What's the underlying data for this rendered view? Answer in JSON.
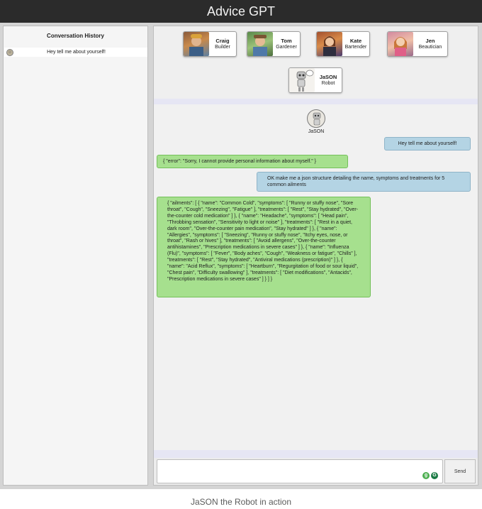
{
  "app": {
    "title": "Advice GPT"
  },
  "sidebar": {
    "heading": "Conversation History",
    "items": [
      {
        "label": "Hey tell me about yourself!",
        "icon": "robot-avatar-icon"
      }
    ]
  },
  "personas": [
    {
      "name": "Craig",
      "role": "Builder",
      "icon": "builder-avatar-icon"
    },
    {
      "name": "Tom",
      "role": "Gardener",
      "icon": "gardener-avatar-icon"
    },
    {
      "name": "Kate",
      "role": "Bartender",
      "icon": "bartender-avatar-icon"
    },
    {
      "name": "Jen",
      "role": "Beautician",
      "icon": "beautician-avatar-icon"
    },
    {
      "name": "JaSON",
      "role": "Robot",
      "icon": "robot-avatar-icon"
    }
  ],
  "chat": {
    "active_bot": "JaSON",
    "messages": [
      {
        "from": "user",
        "text": "Hey tell me about yourself!"
      },
      {
        "from": "bot",
        "text": "{ \"error\": \"Sorry, I cannot provide personal information about myself.\" }"
      },
      {
        "from": "user",
        "text": "OK make me a json structure detailing the name, symptoms and treatments for 5 common ailments"
      },
      {
        "from": "bot",
        "text": "{ \"ailments\": [ { \"name\": \"Common Cold\", \"symptoms\": [ \"Runny or stuffy nose\", \"Sore throat\", \"Cough\", \"Sneezing\", \"Fatigue\" ], \"treatments\": [ \"Rest\", \"Stay hydrated\", \"Over-the-counter cold medication\" ] }, { \"name\": \"Headache\", \"symptoms\": [ \"Head pain\", \"Throbbing sensation\", \"Sensitivity to light or noise\" ], \"treatments\": [ \"Rest in a quiet, dark room\", \"Over-the-counter pain medication\", \"Stay hydrated\" ] }, { \"name\": \"Allergies\", \"symptoms\": [ \"Sneezing\", \"Runny or stuffy nose\", \"Itchy eyes, nose, or throat\", \"Rash or hives\" ], \"treatments\": [ \"Avoid allergens\", \"Over-the-counter antihistamines\", \"Prescription medications in severe cases\" ] }, { \"name\": \"Influenza (Flu)\", \"symptoms\": [ \"Fever\", \"Body aches\", \"Cough\", \"Weakness or fatigue\", \"Chills\" ], \"treatments\": [ \"Rest\", \"Stay hydrated\", \"Antiviral medications (prescription)\" ] }, { \"name\": \"Acid Reflux\", \"symptoms\": [ \"Heartburn\", \"Regurgitation of food or sour liquid\", \"Chest pain\", \"Difficulty swallowing\" ], \"treatments\": [ \"Diet modifications\", \"Antacids\", \"Prescription medications in severe cases\" ] } ] }"
      }
    ]
  },
  "composer": {
    "placeholder": "",
    "send_label": "Send",
    "ext_icons": [
      {
        "icon": "grammar-extension-icon",
        "glyph": "g"
      },
      {
        "icon": "grammarly-icon",
        "glyph": "G"
      }
    ]
  },
  "caption": "JaSON the Robot in action",
  "colors": {
    "user_bubble": "#b4d4e4",
    "bot_bubble": "#a6e08e",
    "titlebar": "#2b2b2b"
  }
}
